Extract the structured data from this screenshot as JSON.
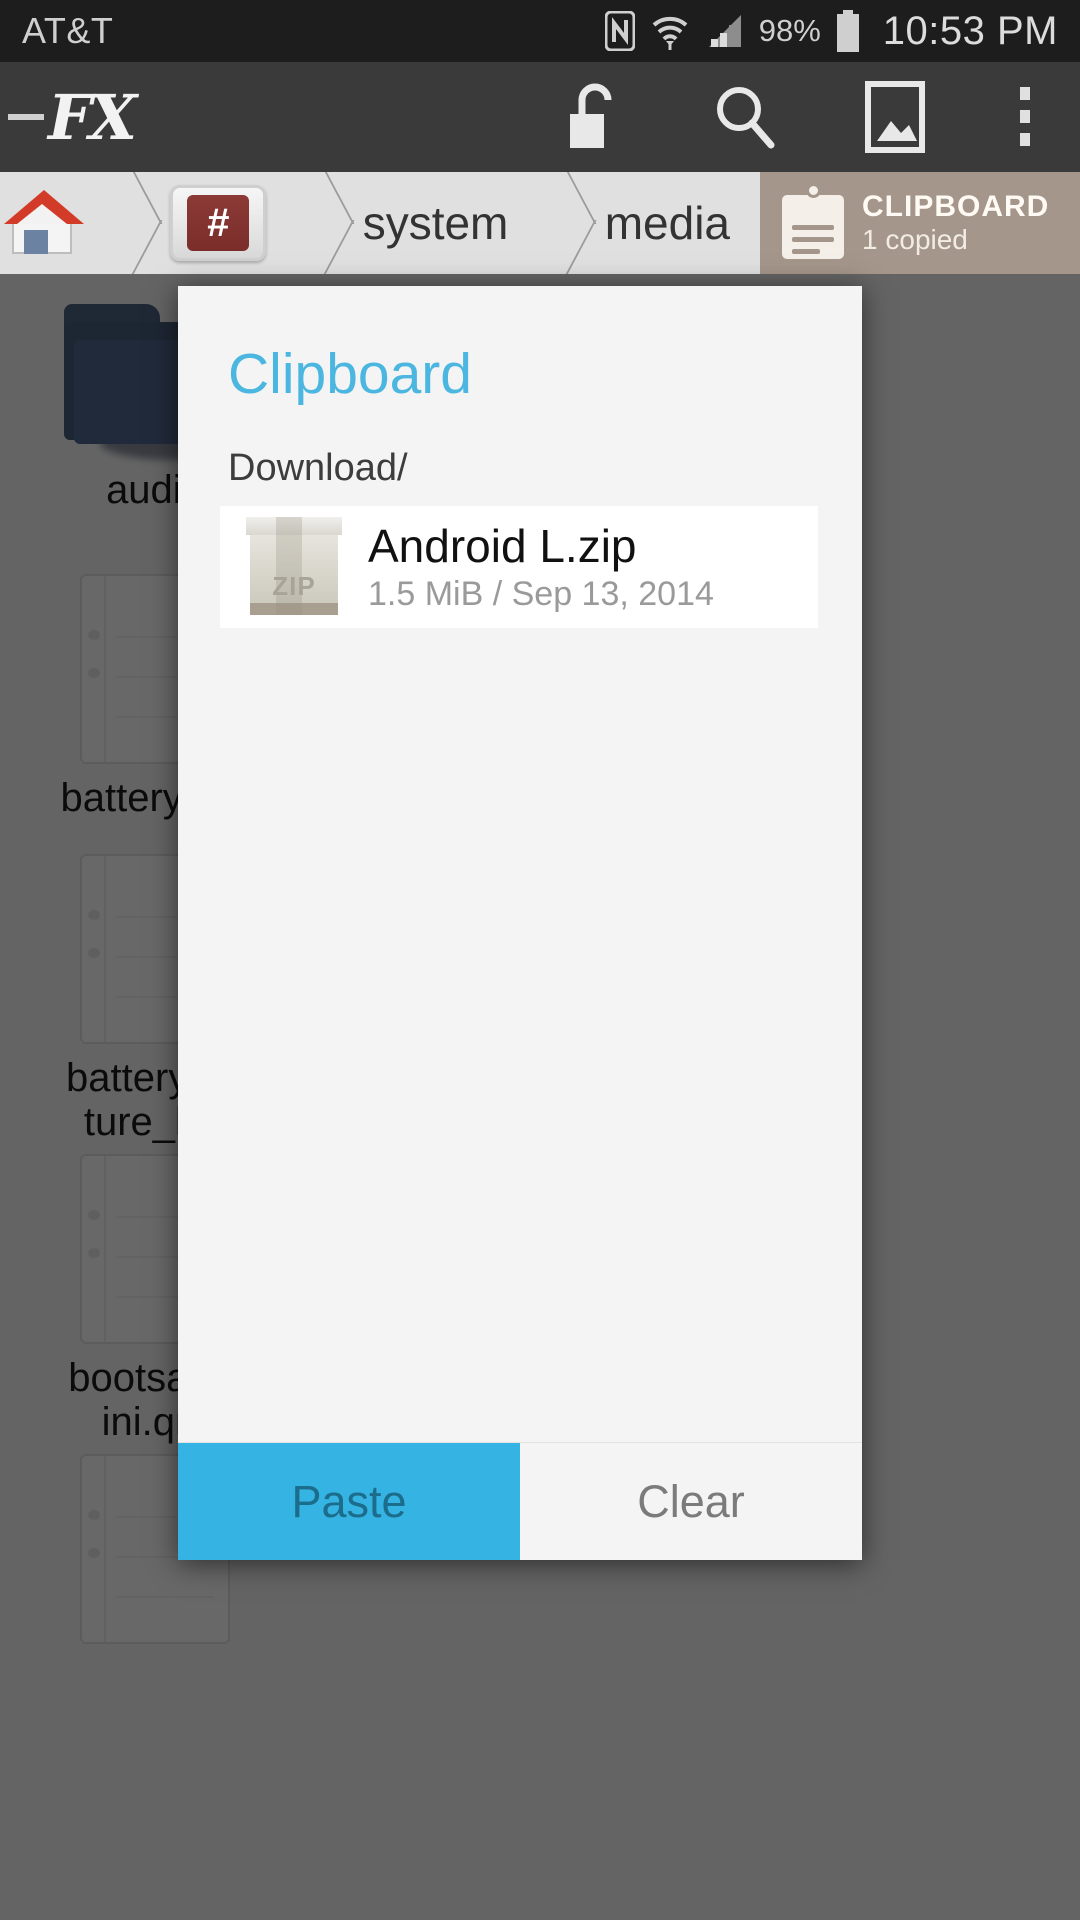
{
  "status_bar": {
    "carrier": "AT&T",
    "battery_percent": "98%",
    "clock": "10:53 PM",
    "icons": [
      "nfc-icon",
      "wifi-icon",
      "cellular-signal-icon",
      "battery-icon"
    ]
  },
  "app_bar": {
    "app_name": "FX",
    "actions": [
      {
        "name": "unlock-icon",
        "label": "Unlock"
      },
      {
        "name": "search-icon",
        "label": "Search"
      },
      {
        "name": "image-icon",
        "label": "Images"
      },
      {
        "name": "overflow-menu-icon",
        "label": "More options"
      }
    ]
  },
  "breadcrumb": {
    "items": [
      {
        "name": "home",
        "label": "",
        "icon": "home-icon"
      },
      {
        "name": "root",
        "label": "#",
        "icon": "root-hash-icon"
      },
      {
        "name": "system",
        "label": "system",
        "icon": ""
      },
      {
        "name": "media",
        "label": "media",
        "icon": ""
      }
    ],
    "clipboard_tab": {
      "title": "CLIPBOARD",
      "subtitle": "1 copied",
      "icon": "clipboard-icon",
      "color": "#a4968a"
    }
  },
  "file_grid": {
    "items": [
      {
        "label": "audio",
        "type": "folder"
      },
      {
        "label": "battery_en",
        "type": "file"
      },
      {
        "label": "battery_te\nture_lim",
        "type": "file"
      },
      {
        "label": "bootsams\nini.qm",
        "type": "file"
      }
    ]
  },
  "dialog": {
    "title": "Clipboard",
    "title_color": "#4bb6e0",
    "path_label": "Download/",
    "entry": {
      "file_name": "Android L.zip",
      "meta": "1.5 MiB / Sep 13, 2014",
      "icon": "zip-file-icon",
      "icon_label": "ZIP"
    },
    "buttons": {
      "paste": "Paste",
      "clear": "Clear",
      "paste_bg": "#35b4e3",
      "paste_fg": "#1c6c8b"
    }
  }
}
